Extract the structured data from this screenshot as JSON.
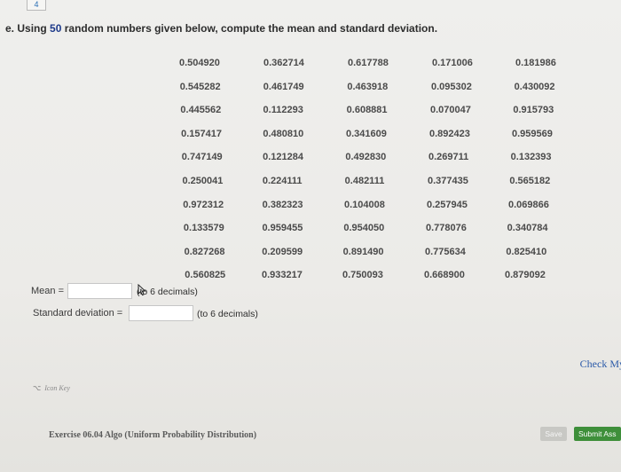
{
  "tab_marker": "4",
  "question": {
    "letter": "e.",
    "text_before": "Using",
    "count": "50",
    "text_after": "random numbers given below, compute the mean and standard deviation."
  },
  "numbers": {
    "columns": [
      [
        "0.504920",
        "0.545282",
        "0.445562",
        "0.157417",
        "0.747149",
        "0.250041",
        "0.972312",
        "0.133579",
        "0.827268",
        "0.560825"
      ],
      [
        "0.362714",
        "0.461749",
        "0.112293",
        "0.480810",
        "0.121284",
        "0.224111",
        "0.382323",
        "0.959455",
        "0.209599",
        "0.933217"
      ],
      [
        "0.617788",
        "0.463918",
        "0.608881",
        "0.341609",
        "0.492830",
        "0.482111",
        "0.104008",
        "0.954050",
        "0.891490",
        "0.750093"
      ],
      [
        "0.171006",
        "0.095302",
        "0.070047",
        "0.892423",
        "0.269711",
        "0.377435",
        "0.257945",
        "0.778076",
        "0.775634",
        "0.668900"
      ],
      [
        "0.181986",
        "0.430092",
        "0.915793",
        "0.959569",
        "0.132393",
        "0.565182",
        "0.069866",
        "0.340784",
        "0.825410",
        "0.879092"
      ]
    ]
  },
  "mean": {
    "label": "Mean =",
    "value": "",
    "hint": "(to 6 decimals)"
  },
  "stdev": {
    "label": "Standard deviation =",
    "value": "",
    "hint": "(to 6 decimals)"
  },
  "check_label": "Check My",
  "icon_key_label": "Icon Key",
  "exercise_label": "Exercise 06.04 Algo (Uniform Probability Distribution)",
  "buttons": {
    "save": "Save",
    "submit": "Submit Ass"
  }
}
